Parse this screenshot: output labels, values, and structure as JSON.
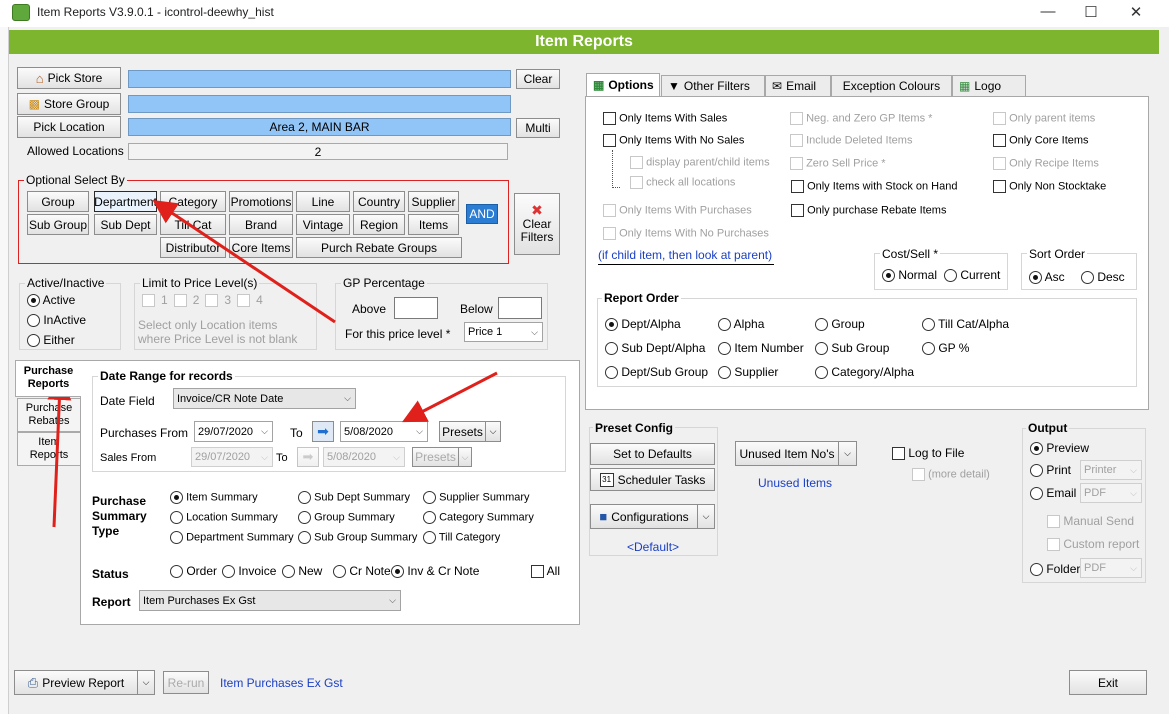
{
  "window": {
    "title": "Item Reports V3.9.0.1 - icontrol-deewhy_hist",
    "banner": "Item Reports",
    "minimize": "—",
    "maximize": "☐",
    "close": "✕"
  },
  "left_buttons": {
    "pick_store": "Pick Store",
    "store_group": "Store Group",
    "pick_location": "Pick Location",
    "allowed_locations_label": "Allowed Locations",
    "clear": "Clear",
    "multi": "Multi"
  },
  "fields": {
    "store": "",
    "store_group": "",
    "location": "Area 2, MAIN BAR",
    "allowed_locations": "2"
  },
  "optional_select": {
    "title": "Optional Select By",
    "row1": [
      "Group",
      "Department",
      "Category",
      "Promotions",
      "Line",
      "Country",
      "Supplier"
    ],
    "row2": [
      "Sub Group",
      "Sub Dept",
      "Till Cat",
      "Brand",
      "Vintage",
      "Region",
      "Items"
    ],
    "row3": [
      "Distributor",
      "Core Items",
      "Purch Rebate Groups"
    ],
    "and_button": "AND",
    "clear_filters": "Clear Filters"
  },
  "active": {
    "title": "Active/Inactive",
    "options": [
      "Active",
      "InActive",
      "Either"
    ],
    "selected": "Active"
  },
  "price_level": {
    "title": "Limit to Price Level(s)",
    "levels": [
      "1",
      "2",
      "3",
      "4"
    ],
    "note": "Select only Location items where Price Level is not blank"
  },
  "gp": {
    "title": "GP Percentage",
    "above": "Above",
    "below": "Below",
    "for_level": "For this price level *",
    "level_value": "Price 1"
  },
  "side_tabs": [
    "Purchase Reports",
    "Purchase Rebates",
    "Item Reports"
  ],
  "date_range": {
    "title": "Date Range for records",
    "date_field_label": "Date Field",
    "date_field_value": "Invoice/CR Note Date",
    "purchases_from": "Purchases From",
    "from_value": "29/07/2020",
    "to": "To",
    "to_value": "5/08/2020",
    "presets": "Presets",
    "sales_from": "Sales From",
    "sales_from_value": "29/07/2020",
    "sales_to_value": "5/08/2020"
  },
  "summary": {
    "title": "Purchase Summary Type",
    "options": [
      "Item Summary",
      "Sub Dept Summary",
      "Supplier Summary",
      "Location Summary",
      "Group Summary",
      "Category Summary",
      "Department Summary",
      "Sub Group Summary",
      "Till Category"
    ],
    "selected": "Item Summary"
  },
  "status": {
    "label": "Status",
    "options": [
      "Order",
      "Invoice",
      "New",
      "Cr Note",
      "Inv & Cr Note"
    ],
    "selected": "Inv & Cr Note",
    "all": "All"
  },
  "report": {
    "label": "Report",
    "value": "Item Purchases Ex Gst"
  },
  "right_tabs": [
    "Options",
    "Other Filters",
    "Email",
    "Exception Colours",
    "Logo"
  ],
  "options": {
    "col1": [
      "Only Items With Sales",
      "Only Items With No Sales",
      "display parent/child items",
      "check all locations",
      "Only Items With Purchases",
      "Only Items With No Purchases"
    ],
    "col2": [
      "Neg. and Zero GP Items *",
      "Include Deleted Items",
      "Zero Sell Price *",
      "Only Items with Stock on Hand",
      "Only purchase Rebate Items"
    ],
    "col3": [
      "Only parent items",
      "Only Core Items",
      "Only Recipe Items",
      "Only Non Stocktake"
    ],
    "child_note": "(if child item, then look at parent)"
  },
  "cost_sell": {
    "title": "Cost/Sell *",
    "options": [
      "Normal",
      "Current"
    ],
    "selected": "Normal"
  },
  "sort_order": {
    "title": "Sort Order",
    "options": [
      "Asc",
      "Desc"
    ],
    "selected": "Asc"
  },
  "report_order": {
    "title": "Report Order",
    "options": [
      "Dept/Alpha",
      "Alpha",
      "Group",
      "Till Cat/Alpha",
      "Sub Dept/Alpha",
      "Item Number",
      "Sub Group",
      "GP %",
      "Dept/Sub Group",
      "Supplier",
      "Category/Alpha"
    ],
    "selected": "Dept/Alpha"
  },
  "preset": {
    "title": "Preset Config",
    "defaults": "Set to Defaults",
    "scheduler": "Scheduler Tasks",
    "configurations": "Configurations",
    "default_link": "<Default>",
    "scheduler_day": "31"
  },
  "unused": {
    "button": "Unused Item No's",
    "link": "Unused Items"
  },
  "log": {
    "label": "Log to File",
    "more": "(more detail)"
  },
  "output": {
    "title": "Output",
    "options": [
      "Preview",
      "Print",
      "Email",
      "Folder"
    ],
    "selected": "Preview",
    "printer": "Printer",
    "pdf": "PDF",
    "manual_send": "Manual Send",
    "custom_report": "Custom report"
  },
  "footer": {
    "preview": "Preview Report",
    "rerun": "Re-run",
    "current_report": "Item Purchases Ex Gst",
    "exit": "Exit"
  }
}
